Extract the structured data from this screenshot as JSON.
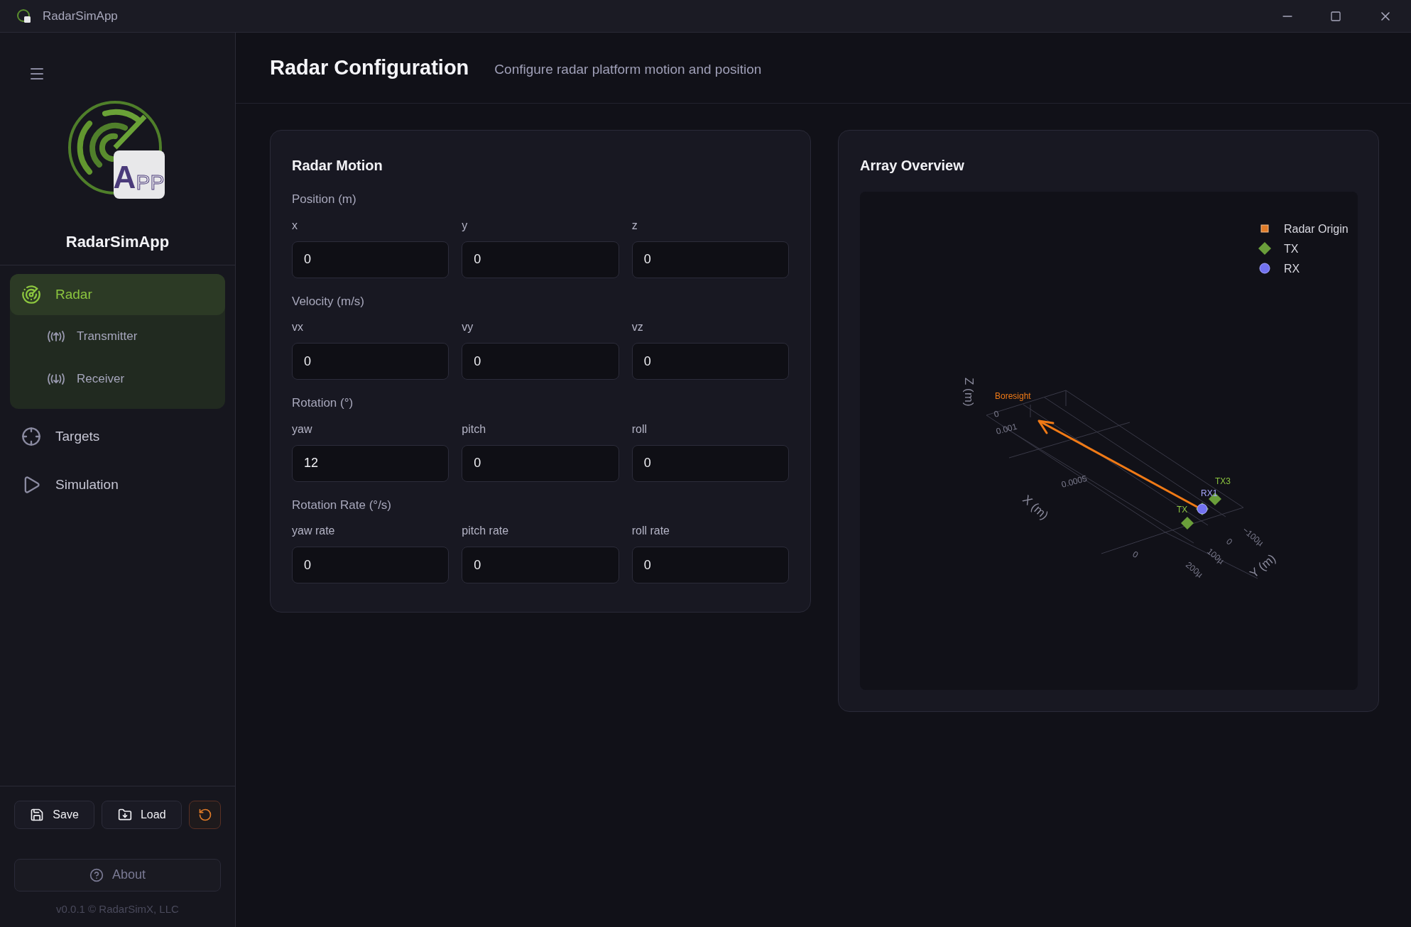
{
  "window": {
    "title": "RadarSimApp"
  },
  "sidebar": {
    "logo_letters": [
      "A",
      "PP"
    ],
    "app_name": "RadarSimApp",
    "nav": [
      {
        "label": "Radar",
        "selected": true,
        "expanded": true,
        "children": [
          {
            "label": "Transmitter",
            "selected": false
          },
          {
            "label": "Receiver",
            "selected": false
          }
        ]
      },
      {
        "label": "Targets",
        "selected": false
      },
      {
        "label": "Simulation",
        "selected": false
      }
    ],
    "buttons": [
      {
        "kind": "save",
        "label": "Save"
      },
      {
        "kind": "load",
        "label": "Load"
      },
      {
        "kind": "reset"
      }
    ],
    "about": "About",
    "footer": "v0.0.1 © RadarSimX, LLC"
  },
  "header": {
    "title": "Radar Configuration",
    "subtitle": "Configure radar platform motion and position"
  },
  "radar_motion": {
    "title": "Radar Motion",
    "groups": [
      {
        "label": "Position (m)",
        "fields": [
          {
            "label": "x",
            "value": "0"
          },
          {
            "label": "y",
            "value": "0"
          },
          {
            "label": "z",
            "value": "0"
          }
        ]
      },
      {
        "label": "Velocity (m/s)",
        "fields": [
          {
            "label": "vx",
            "value": "0"
          },
          {
            "label": "vy",
            "value": "0"
          },
          {
            "label": "vz",
            "value": "0"
          }
        ]
      },
      {
        "label": "Rotation (°)",
        "fields": [
          {
            "label": "yaw",
            "value": "12"
          },
          {
            "label": "pitch",
            "value": "0"
          },
          {
            "label": "roll",
            "value": "0"
          }
        ]
      },
      {
        "label": "Rotation Rate (°/s)",
        "fields": [
          {
            "label": "yaw rate",
            "value": "0"
          },
          {
            "label": "pitch rate",
            "value": "0"
          },
          {
            "label": "roll rate",
            "value": "0"
          }
        ]
      }
    ]
  },
  "array_overview": {
    "title": "Array Overview",
    "legend": [
      {
        "label": "Radar Origin",
        "kind": "square",
        "color": "#e07b28"
      },
      {
        "label": "TX",
        "kind": "diamond",
        "color": "#6a9e3a"
      },
      {
        "label": "RX",
        "kind": "circle",
        "color": "#7272f0"
      }
    ],
    "plot": {
      "boresight_label": "Boresight",
      "axis_titles": [
        "Z (m)",
        "X (m)",
        "Y (m)"
      ],
      "ticks": [
        "0",
        "0.001",
        "0.0005",
        "0",
        "200µ",
        "100µ",
        "0",
        "−100µ"
      ],
      "markers": [
        {
          "kind": "tx",
          "label": "TX3"
        },
        {
          "kind": "tx",
          "label": "TX"
        },
        {
          "kind": "tx"
        },
        {
          "kind": "rx",
          "label": "RX1"
        }
      ]
    }
  }
}
